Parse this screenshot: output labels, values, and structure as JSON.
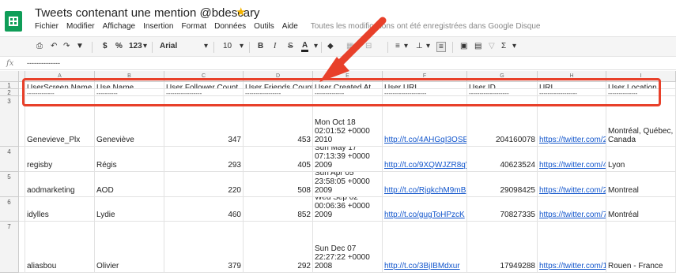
{
  "app": {
    "title": "Tweets contenant une mention @bdescary",
    "menu": [
      "Fichier",
      "Modifier",
      "Affichage",
      "Insertion",
      "Format",
      "Données",
      "Outils",
      "Aide"
    ],
    "save_status": "Toutes les modifications ont été enregistrées dans Google Disque"
  },
  "toolbar": {
    "currency": "$",
    "percent": "%",
    "number_format": "123",
    "font": "Arial",
    "font_size": "10",
    "bold": "B",
    "italic": "I",
    "strike": "S",
    "text_color": "A",
    "sum": "Σ"
  },
  "formula_bar": {
    "fx": "fx",
    "value": "--------------"
  },
  "columns": [
    "A",
    "B",
    "C",
    "D",
    "E",
    "F",
    "G",
    "H",
    "I"
  ],
  "rows": [
    "1",
    "2",
    "3",
    "4",
    "5",
    "6",
    "7"
  ],
  "headers": [
    "UserScreen Name",
    "Use Name",
    "User Follower Count",
    "User Friends Count",
    "User Created At",
    "User URL",
    "User ID",
    "URL",
    "User Location"
  ],
  "dashes": [
    "-------------",
    "----------",
    "-----------------",
    "-----------------",
    "--------------",
    "--------------------",
    "-------------------",
    "------------------",
    "--------------"
  ],
  "records": [
    {
      "screen": "Genevieve_Plx",
      "name": "Geneviève",
      "followers": "347",
      "friends": "453",
      "created": "Mon Oct 18\n02:01:52 +0000\n2010",
      "user_url": "http://t.co/4AHGqI3OSE",
      "id": "204160078",
      "url": "https://twitter.com/2",
      "location": "Montréal, Québec,\nCanada"
    },
    {
      "screen": "regisby",
      "name": "Régis",
      "followers": "293",
      "friends": "405",
      "created": "Sun May 17\n07:13:39 +0000\n2009",
      "user_url": "http://t.co/9XQWJZR8qV",
      "id": "40623524",
      "url": "https://twitter.com/4",
      "location": "Lyon"
    },
    {
      "screen": "aodmarketing",
      "name": "AOD",
      "followers": "220",
      "friends": "508",
      "created": "Sun Apr 05\n23:58:05 +0000\n2009",
      "user_url": "http://t.co/RjqkchM9mB",
      "id": "29098425",
      "url": "https://twitter.com/2",
      "location": "Montreal"
    },
    {
      "screen": "idylles",
      "name": "Lydie",
      "followers": "460",
      "friends": "852",
      "created": "Wed Sep 02\n00:06:36 +0000\n2009",
      "user_url": "http://t.co/gugToHPzcK",
      "id": "70827335",
      "url": "https://twitter.com/7",
      "location": "Montréal"
    },
    {
      "screen": "aliasbou",
      "name": "Olivier",
      "followers": "379",
      "friends": "292",
      "created": "Sun Dec 07\n22:27:22 +0000\n2008",
      "user_url": "http://t.co/3BjIBMdxur",
      "id": "17949288",
      "url": "https://twitter.com/1",
      "location": "Rouen - France"
    }
  ],
  "colors": {
    "highlight": "#e8402a",
    "link": "#1155cc",
    "logo": "#0f9d58",
    "star": "#f4b400"
  }
}
